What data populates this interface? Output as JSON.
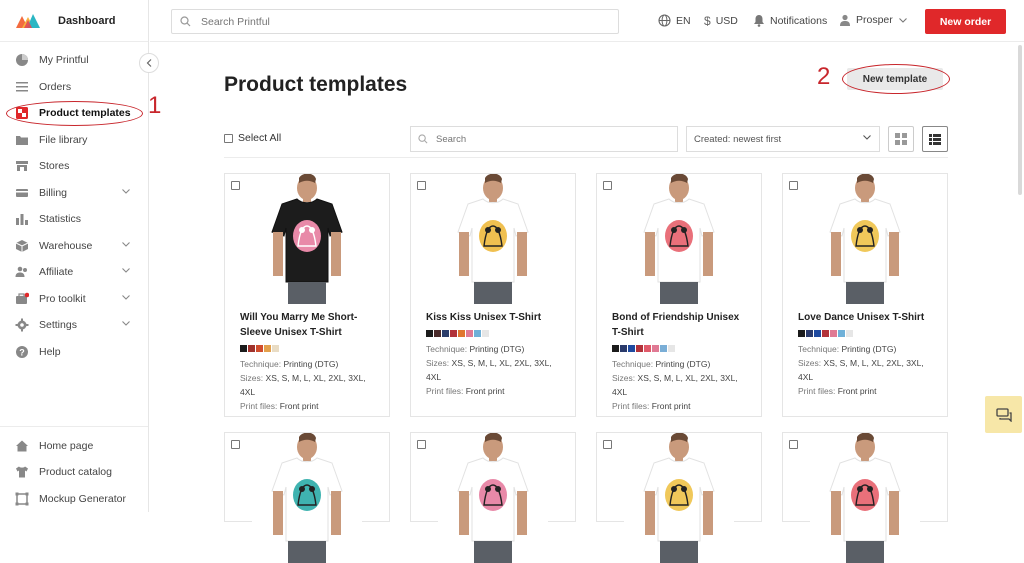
{
  "app": {
    "title": "Dashboard"
  },
  "colors": {
    "accent": "#e0282a",
    "annotation": "#c8262c"
  },
  "sidebar": {
    "items": [
      {
        "label": "My Printful",
        "icon": "pie-chart-icon"
      },
      {
        "label": "Orders",
        "icon": "list-icon"
      },
      {
        "label": "Product templates",
        "icon": "templates-icon",
        "active": true
      },
      {
        "label": "File library",
        "icon": "folder-icon"
      },
      {
        "label": "Stores",
        "icon": "store-icon"
      },
      {
        "label": "Billing",
        "icon": "credit-card-icon",
        "expandable": true
      },
      {
        "label": "Statistics",
        "icon": "bar-chart-icon"
      },
      {
        "label": "Warehouse",
        "icon": "box-icon",
        "expandable": true
      },
      {
        "label": "Affiliate",
        "icon": "users-icon",
        "expandable": true
      },
      {
        "label": "Pro toolkit",
        "icon": "toolkit-icon",
        "expandable": true,
        "badge": true
      },
      {
        "label": "Settings",
        "icon": "gear-icon",
        "expandable": true
      },
      {
        "label": "Help",
        "icon": "help-icon"
      }
    ],
    "bottom": [
      {
        "label": "Home page",
        "icon": "home-icon"
      },
      {
        "label": "Product catalog",
        "icon": "shirt-icon"
      },
      {
        "label": "Mockup Generator",
        "icon": "mockup-icon"
      }
    ]
  },
  "topbar": {
    "search_placeholder": "Search Printful",
    "language": "EN",
    "currency": "USD",
    "notifications": "Notifications",
    "user": "Prosper",
    "new_order": "New order"
  },
  "main": {
    "title": "Product templates",
    "new_template": "New template",
    "select_all": "Select All",
    "search_placeholder": "Search",
    "sort": "Created: newest first"
  },
  "annotations": {
    "one": "1",
    "two": "2"
  },
  "labels": {
    "technique": "Technique:",
    "sizes": "Sizes:",
    "print_files": "Print files:"
  },
  "cards": [
    {
      "title": "Will You Marry Me Short-Sleeve Unisex T-Shirt",
      "shirt": "#1c1c1c",
      "art": "#e889a8",
      "swatches": [
        "#1b1b1b",
        "#a0322c",
        "#d14d2d",
        "#e3a04c",
        "#e9dcc4"
      ],
      "technique": "Printing (DTG)",
      "sizes": "XS, S, M, L, XL, 2XL, 3XL, 4XL",
      "print_files": "Front print"
    },
    {
      "title": "Kiss Kiss Unisex T-Shirt",
      "shirt": "#ffffff",
      "art": "#f0c050",
      "swatches": [
        "#1b1b1b",
        "#4a2a2a",
        "#2b3d6b",
        "#b2323a",
        "#e0762e",
        "#e07a94",
        "#6fb0d8",
        "#e6e6e6"
      ],
      "technique": "Printing (DTG)",
      "sizes": "XS, S, M, L, XL, 2XL, 3XL, 4XL",
      "print_files": "Front print"
    },
    {
      "title": "Bond of Friendship Unisex T-Shirt",
      "shirt": "#ffffff",
      "art": "#e9707a",
      "swatches": [
        "#1b1b1b",
        "#2a3a6b",
        "#1f4aa0",
        "#b2323a",
        "#e05a6a",
        "#e07a94",
        "#7aaed6",
        "#e6e6e6"
      ],
      "technique": "Printing (DTG)",
      "sizes": "XS, S, M, L, XL, 2XL, 3XL, 4XL",
      "print_files": "Front print"
    },
    {
      "title": "Love Dance Unisex T-Shirt",
      "shirt": "#ffffff",
      "art": "#f0c85a",
      "swatches": [
        "#1b1b1b",
        "#2a3a6b",
        "#1f4aa0",
        "#b2323a",
        "#e07a94",
        "#6fb0d8",
        "#e6e6e6"
      ],
      "technique": "Printing (DTG)",
      "sizes": "XS, S, M, L, XL, 2XL, 3XL, 4XL",
      "print_files": "Front print"
    }
  ],
  "cards_row2": [
    {
      "shirt": "#ffffff",
      "art": "#3fb3b0"
    },
    {
      "shirt": "#ffffff",
      "art": "#e889a8"
    },
    {
      "shirt": "#ffffff",
      "art": "#f0c85a"
    },
    {
      "shirt": "#ffffff",
      "art": "#e9707a"
    }
  ]
}
